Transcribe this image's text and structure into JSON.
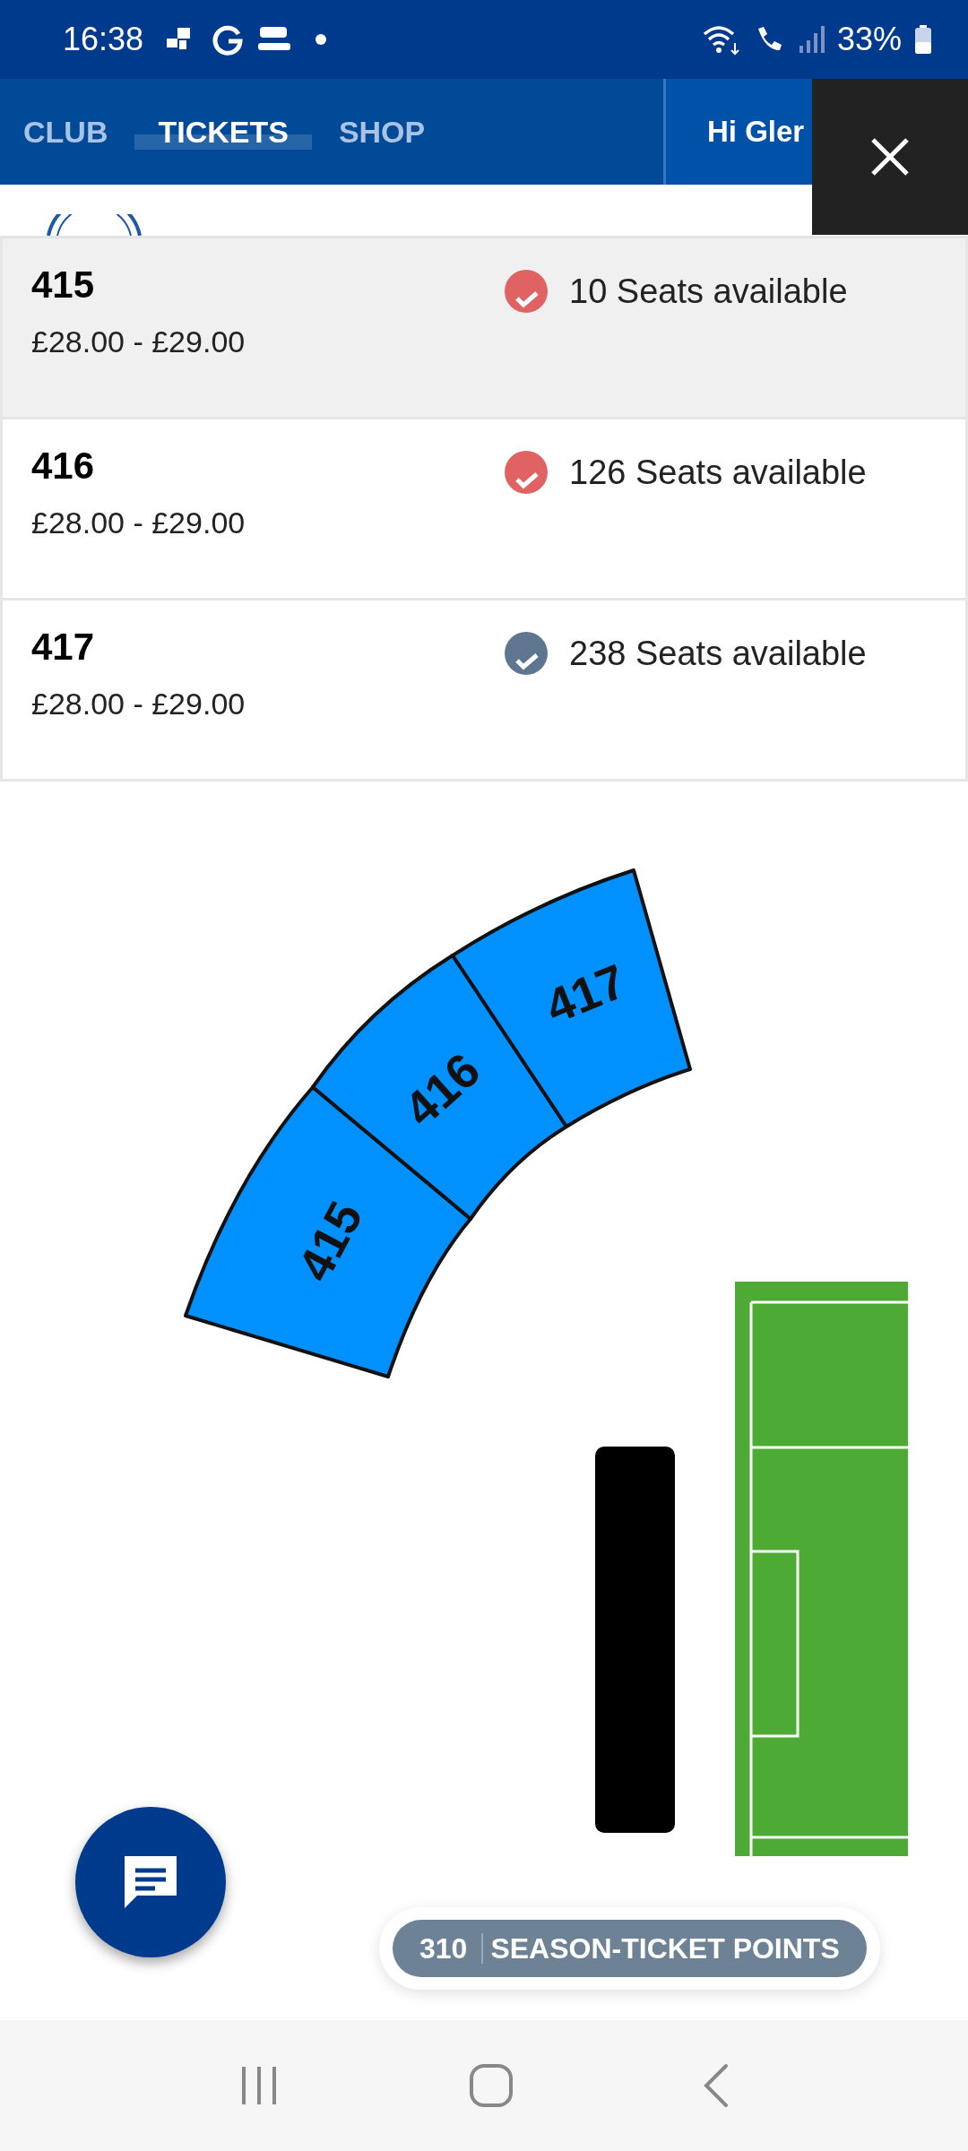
{
  "status_bar": {
    "time": "16:38",
    "battery": "33%"
  },
  "nav": {
    "tabs": [
      {
        "label": "CLUB",
        "selected": false
      },
      {
        "label": "TICKETS",
        "selected": true
      },
      {
        "label": "SHOP",
        "selected": false
      }
    ],
    "greeting": "Hi Gler"
  },
  "sections": [
    {
      "name": "415",
      "price": "£28.00 - £29.00",
      "availability": "10 Seats available",
      "color": "#e06262",
      "selected": true
    },
    {
      "name": "416",
      "price": "£28.00 - £29.00",
      "availability": "126 Seats available",
      "color": "#e06262",
      "selected": false
    },
    {
      "name": "417",
      "price": "£28.00 - £29.00",
      "availability": "238 Seats available",
      "color": "#5f7690",
      "selected": false
    }
  ],
  "map": {
    "sections": [
      {
        "label": "415"
      },
      {
        "label": "416"
      },
      {
        "label": "417"
      }
    ]
  },
  "points": {
    "value": "310",
    "label": "SEASON-TICKET POINTS"
  }
}
